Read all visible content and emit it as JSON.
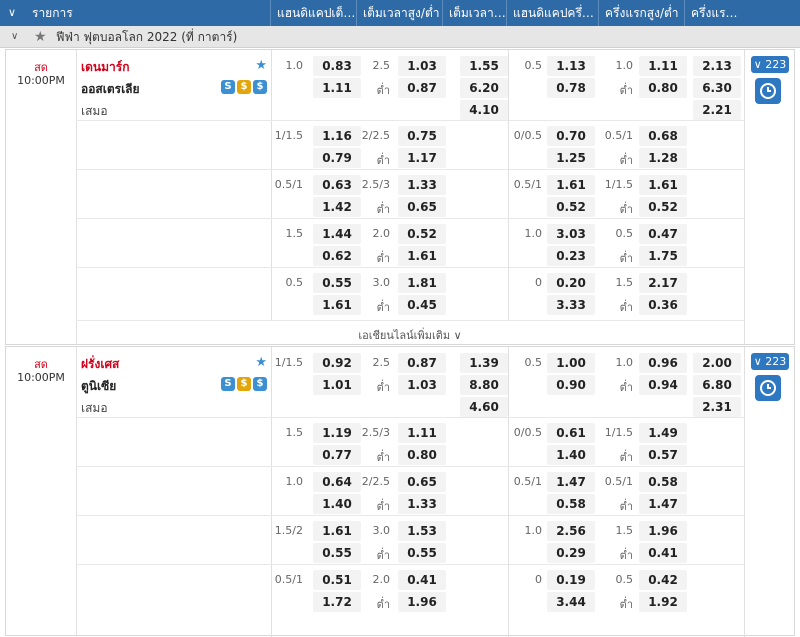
{
  "header": {
    "columns": [
      "รายการ",
      "แฮนดิแคปเต็ม...",
      "เต็มเวลาสูง/ต่ำ",
      "เต็มเวลา ...",
      "แฮนดิแคปครึ่ง...",
      "ครึ่งแรกสูง/ต่ำ",
      "ครึ่งแรก ..."
    ]
  },
  "league": {
    "name": "ฟีฟ่า ฟุตบอลโลก 2022 (ที่ กาตาร์)"
  },
  "matches": [
    {
      "status": "สด",
      "time": "10:00PM",
      "home": "เดนมาร์ก",
      "away": "ออสเตรเลีย",
      "draw": "เสมอ",
      "count": "223",
      "more": "เอเชียนไลน์เพิ่มเติม",
      "rows": [
        {
          "hdp": "1.0",
          "h1": "0.83",
          "h2": "1.11",
          "ou": "2.5",
          "o1": "1.03",
          "o2": "0.87",
          "x1": "1.55",
          "x2": "6.20",
          "x3": "4.10",
          "fhdp": "0.5",
          "f1": "1.13",
          "f2": "0.78",
          "fou": "1.0",
          "fo1": "1.11",
          "fo2": "0.80",
          "fx1": "2.13",
          "fx2": "6.30",
          "fx3": "2.21"
        },
        {
          "hdp": "1/1.5",
          "h1": "1.16",
          "h2": "0.79",
          "ou": "2/2.5",
          "o1": "0.75",
          "o2": "1.17",
          "fhdp": "0/0.5",
          "f1": "0.70",
          "f2": "1.25",
          "fou": "0.5/1",
          "fo1": "0.68",
          "fo2": "1.28"
        },
        {
          "hdp": "0.5/1",
          "h1": "0.63",
          "h2": "1.42",
          "ou": "2.5/3",
          "o1": "1.33",
          "o2": "0.65",
          "fhdp": "0.5/1",
          "f1": "1.61",
          "f2": "0.52",
          "fou": "1/1.5",
          "fo1": "1.61",
          "fo2": "0.52"
        },
        {
          "hdp": "1.5",
          "h1": "1.44",
          "h2": "0.62",
          "ou": "2.0",
          "o1": "0.52",
          "o2": "1.61",
          "fhdp": "1.0",
          "f1": "3.03",
          "f2": "0.23",
          "fou": "0.5",
          "fo1": "0.47",
          "fo2": "1.75"
        },
        {
          "hdp": "0.5",
          "h1": "0.55",
          "h2": "1.61",
          "ou": "3.0",
          "o1": "1.81",
          "o2": "0.45",
          "fhdp": "0",
          "f1": "0.20",
          "f2": "3.33",
          "fou": "1.5",
          "fo1": "2.17",
          "fo2": "0.36"
        }
      ]
    },
    {
      "status": "สด",
      "time": "10:00PM",
      "home": "ฝรั่งเศส",
      "away": "ตูนิเซีย",
      "draw": "เสมอ",
      "count": "223",
      "rows": [
        {
          "hdp": "1/1.5",
          "h1": "0.92",
          "h2": "1.01",
          "ou": "2.5",
          "o1": "0.87",
          "o2": "1.03",
          "x1": "1.39",
          "x2": "8.80",
          "x3": "4.60",
          "fhdp": "0.5",
          "f1": "1.00",
          "f2": "0.90",
          "fou": "1.0",
          "fo1": "0.96",
          "fo2": "0.94",
          "fx1": "2.00",
          "fx2": "6.80",
          "fx3": "2.31"
        },
        {
          "hdp": "1.5",
          "h1": "1.19",
          "h2": "0.77",
          "ou": "2.5/3",
          "o1": "1.11",
          "o2": "0.80",
          "fhdp": "0/0.5",
          "f1": "0.61",
          "f2": "1.40",
          "fou": "1/1.5",
          "fo1": "1.49",
          "fo2": "0.57"
        },
        {
          "hdp": "1.0",
          "h1": "0.64",
          "h2": "1.40",
          "ou": "2/2.5",
          "o1": "0.65",
          "o2": "1.33",
          "fhdp": "0.5/1",
          "f1": "1.47",
          "f2": "0.58",
          "fou": "0.5/1",
          "fo1": "0.58",
          "fo2": "1.47"
        },
        {
          "hdp": "1.5/2",
          "h1": "1.61",
          "h2": "0.55",
          "ou": "3.0",
          "o1": "1.53",
          "o2": "0.55",
          "fhdp": "1.0",
          "f1": "2.56",
          "f2": "0.29",
          "fou": "1.5",
          "fo1": "1.96",
          "fo2": "0.41"
        },
        {
          "hdp": "0.5/1",
          "h1": "0.51",
          "h2": "1.72",
          "ou": "2.0",
          "o1": "0.41",
          "o2": "1.96",
          "fhdp": "0",
          "f1": "0.19",
          "f2": "3.44",
          "fou": "0.5",
          "fo1": "0.42",
          "fo2": "1.92"
        }
      ]
    }
  ],
  "labels": {
    "under": "ต่ำ"
  },
  "icons": {
    "chevron": "chevron-down-icon",
    "star": "star-icon",
    "clock": "clock-icon"
  },
  "colors": {
    "header": "#2e6aa6",
    "home_team": "#d0021b",
    "accent": "#2e78c2"
  }
}
